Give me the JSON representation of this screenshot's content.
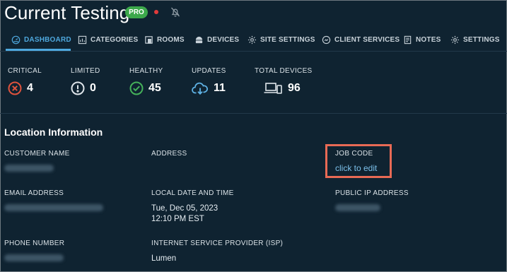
{
  "header": {
    "site_name": "Current Testing",
    "badge": "PRO",
    "status_dot_color": "#e23b3b",
    "notifications_icon": "bell-slash-icon"
  },
  "tabs": [
    {
      "label": "DASHBOARD",
      "icon": "dashboard-gauge-icon",
      "active": true
    },
    {
      "label": "CATEGORIES",
      "icon": "categories-chart-icon",
      "active": false
    },
    {
      "label": "ROOMS",
      "icon": "room-icon",
      "active": false
    },
    {
      "label": "DEVICES",
      "icon": "devices-icon",
      "active": false
    },
    {
      "label": "SITE SETTINGS",
      "icon": "gear-icon",
      "active": false
    },
    {
      "label": "CLIENT SERVICES",
      "icon": "client-services-icon",
      "active": false
    },
    {
      "label": "NOTES",
      "icon": "notes-icon",
      "active": false
    },
    {
      "label": "SETTINGS",
      "icon": "gear-icon",
      "active": false
    }
  ],
  "stats": [
    {
      "label": "CRITICAL",
      "value": "4",
      "icon": "x-circle-icon",
      "color": "#e0533d"
    },
    {
      "label": "LIMITED",
      "value": "0",
      "icon": "exclamation-circle-icon",
      "color": "#dfe6eb"
    },
    {
      "label": "HEALTHY",
      "value": "45",
      "icon": "check-circle-icon",
      "color": "#45b25a"
    },
    {
      "label": "UPDATES",
      "value": "11",
      "icon": "cloud-download-icon",
      "color": "#5fb3e6"
    },
    {
      "label": "TOTAL DEVICES",
      "value": "96",
      "icon": "laptop-phone-icon",
      "color": "#dfe6eb"
    }
  ],
  "location": {
    "title": "Location Information",
    "customer_name": {
      "label": "CUSTOMER NAME"
    },
    "address": {
      "label": "ADDRESS"
    },
    "job_code": {
      "label": "JOB CODE",
      "action": "click to edit"
    },
    "email_address": {
      "label": "EMAIL ADDRESS"
    },
    "local_date_time": {
      "label": "LOCAL DATE AND TIME",
      "date": "Tue, Dec 05, 2023",
      "time": "12:10 PM EST"
    },
    "public_ip": {
      "label": "PUBLIC IP ADDRESS"
    },
    "phone_number": {
      "label": "PHONE NUMBER"
    },
    "isp": {
      "label": "INTERNET SERVICE PROVIDER (ISP)",
      "value": "Lumen"
    }
  },
  "accent_color": "#4ea8de",
  "highlight_color": "#e86a55"
}
